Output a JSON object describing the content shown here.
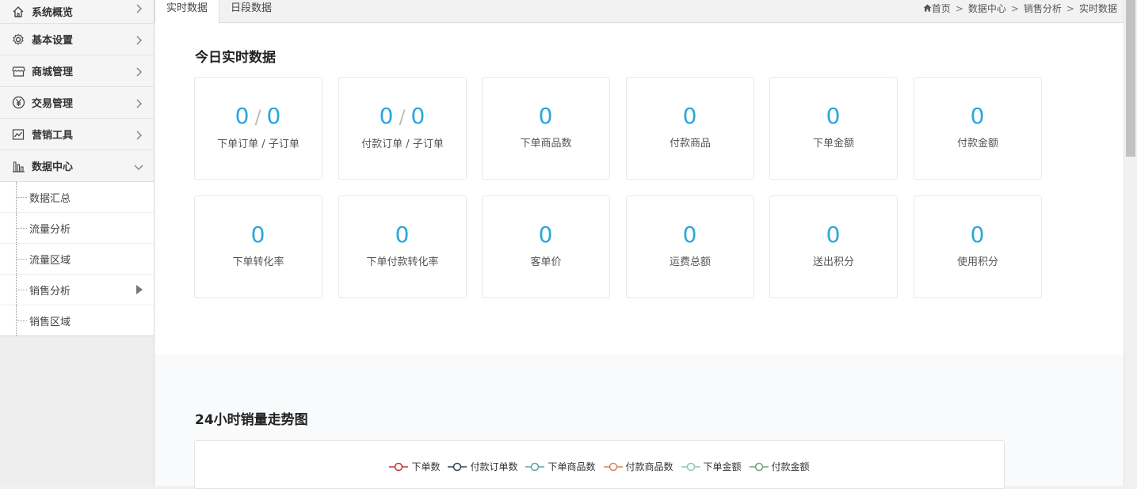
{
  "sidebar": {
    "items": [
      {
        "label": "系统概览",
        "icon": "home-icon"
      },
      {
        "label": "基本设置",
        "icon": "gear-icon"
      },
      {
        "label": "商城管理",
        "icon": "store-icon"
      },
      {
        "label": "交易管理",
        "icon": "yen-icon"
      },
      {
        "label": "营销工具",
        "icon": "chart-line-icon"
      },
      {
        "label": "数据中心",
        "icon": "bar-chart-icon",
        "expanded": true
      }
    ],
    "subitems": [
      {
        "label": "数据汇总"
      },
      {
        "label": "流量分析"
      },
      {
        "label": "流量区域"
      },
      {
        "label": "销售分析",
        "has_arrow": true
      },
      {
        "label": "销售区域"
      }
    ]
  },
  "tabs": [
    {
      "label": "实时数据",
      "active": true
    },
    {
      "label": "日段数据",
      "active": false
    }
  ],
  "breadcrumb": {
    "home": "首页",
    "items": [
      "数据中心",
      "销售分析",
      "实时数据"
    ],
    "separator": ">"
  },
  "today": {
    "title": "今日实时数据",
    "cards": [
      {
        "value": "0",
        "value2": "0",
        "label": "下单订单 / 子订单"
      },
      {
        "value": "0",
        "value2": "0",
        "label": "付款订单 / 子订单"
      },
      {
        "value": "0",
        "label": "下单商品数"
      },
      {
        "value": "0",
        "label": "付款商品"
      },
      {
        "value": "0",
        "label": "下单金额"
      },
      {
        "value": "0",
        "label": "付款金额"
      },
      {
        "value": "0",
        "label": "下单转化率"
      },
      {
        "value": "0",
        "label": "下单付款转化率"
      },
      {
        "value": "0",
        "label": "客单价"
      },
      {
        "value": "0",
        "label": "运费总额"
      },
      {
        "value": "0",
        "label": "送出积分"
      },
      {
        "value": "0",
        "label": "使用积分"
      }
    ]
  },
  "trend": {
    "title": "24小时销量走势图",
    "legend": [
      {
        "name": "下单数",
        "color": "#c23531"
      },
      {
        "name": "付款订单数",
        "color": "#2f4554"
      },
      {
        "name": "下单商品数",
        "color": "#61a0a8"
      },
      {
        "name": "付款商品数",
        "color": "#d48265"
      },
      {
        "name": "下单金额",
        "color": "#91c7ae"
      },
      {
        "name": "付款金额",
        "color": "#749f83"
      }
    ]
  },
  "colors": {
    "accent": "#2aa7dc"
  }
}
